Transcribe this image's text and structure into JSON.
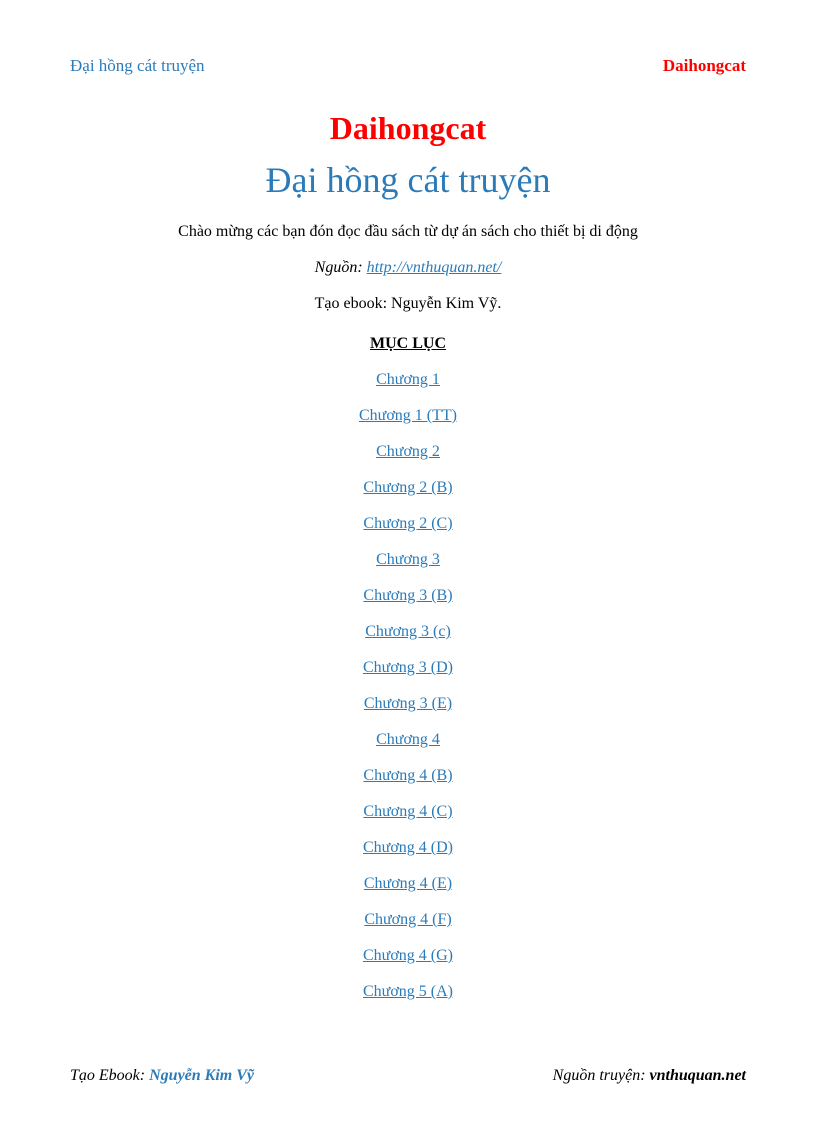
{
  "header": {
    "left": "Đại hồng cát truyện",
    "right": "Daihongcat"
  },
  "title": {
    "author": "Daihongcat",
    "book": "Đại hồng cát truyện"
  },
  "intro": "Chào mừng các bạn đón đọc đầu sách từ dự án sách cho thiết bị di động",
  "source": {
    "label": "Nguồn: ",
    "url": "http://vnthuquan.net/"
  },
  "creator": "Tạo ebook: Nguyễn Kim Vỹ.",
  "toc": {
    "heading": "MỤC LỤC",
    "items": [
      "Chương 1",
      "Chương 1 (TT)",
      "Chương 2",
      "Chương 2 (B)",
      "Chương 2 (C)",
      "Chương 3",
      "Chương 3 (B)",
      "Chương 3 (c)",
      "Chương 3 (D)",
      "Chương 3 (E)",
      "Chương 4",
      "Chương 4 (B)",
      "Chương 4 (C)",
      "Chương 4 (D)",
      "Chương 4 (E)",
      "Chương 4 (F)",
      "Chương 4 (G)",
      "Chương 5 (A)"
    ]
  },
  "footer": {
    "left_label": "Tạo Ebook",
    "left_sep": ": ",
    "left_name": "Nguyễn Kim Vỹ",
    "right_label": "Nguồn truyện",
    "right_sep": ": ",
    "right_src": "vnthuquan.net"
  }
}
